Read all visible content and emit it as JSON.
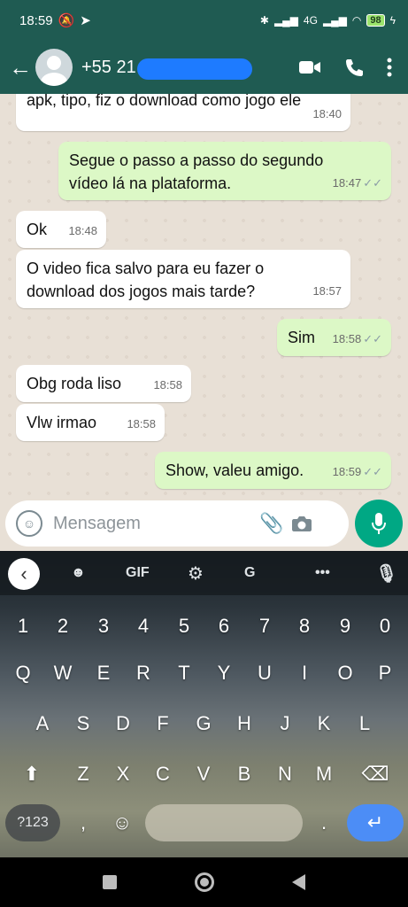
{
  "status": {
    "time": "18:59",
    "network": "4G",
    "battery": "98"
  },
  "appbar": {
    "contact_name": "+55 21"
  },
  "messages": [
    {
      "text": "apk, tipo, fiz o download como jogo ele",
      "time": "18:40",
      "direction": "in"
    },
    {
      "text": "Segue o passo a passo do segundo vídeo lá na plataforma.",
      "time": "18:47",
      "direction": "out"
    },
    {
      "text": "Ok",
      "time": "18:48",
      "direction": "in"
    },
    {
      "text": "O video fica salvo para eu fazer o download dos jogos mais tarde?",
      "time": "18:57",
      "direction": "in"
    },
    {
      "text": "Sim",
      "time": "18:58",
      "direction": "out"
    },
    {
      "text": "Obg roda liso",
      "time": "18:58",
      "direction": "in"
    },
    {
      "text": "Vlw irmao",
      "time": "18:58",
      "direction": "in"
    },
    {
      "text": "Show, valeu amigo.",
      "time": "18:59",
      "direction": "out"
    }
  ],
  "composer": {
    "placeholder": "Mensagem"
  },
  "keyboard": {
    "toolbar": [
      "GIF"
    ],
    "numbers": [
      "1",
      "2",
      "3",
      "4",
      "5",
      "6",
      "7",
      "8",
      "9",
      "0"
    ],
    "row1": [
      "Q",
      "W",
      "E",
      "R",
      "T",
      "Y",
      "U",
      "I",
      "O",
      "P"
    ],
    "row2": [
      "A",
      "S",
      "D",
      "F",
      "G",
      "H",
      "J",
      "K",
      "L"
    ],
    "row3": [
      "Z",
      "X",
      "C",
      "V",
      "B",
      "N",
      "M"
    ],
    "symbols_key": "?123",
    "comma": ",",
    "period": "."
  },
  "colors": {
    "header": "#1f5b52",
    "outgoing_bubble": "#dcf8c6",
    "incoming_bubble": "#ffffff",
    "mic_button": "#00a884",
    "enter_key": "#4c8df6"
  }
}
